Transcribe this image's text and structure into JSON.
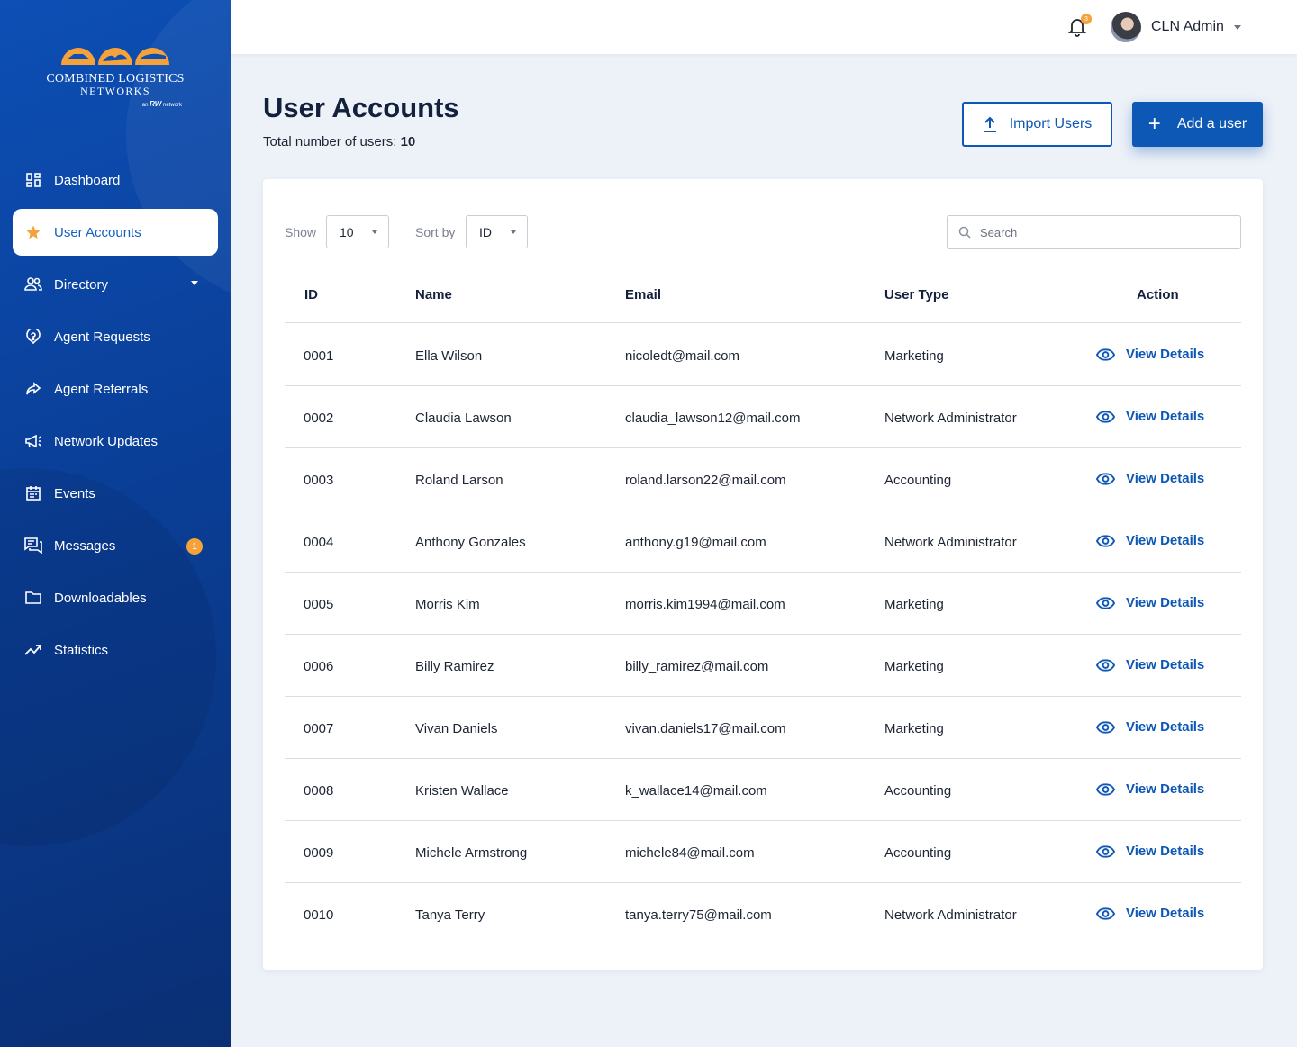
{
  "brand": {
    "name_line1": "COMBINED LOGISTICS",
    "name_line2": "NETWORKS",
    "tagline_prefix": "an",
    "tagline_brand": "RW",
    "tagline_suffix": "network"
  },
  "sidebar": {
    "items": [
      {
        "label": "Dashboard",
        "icon": "dashboard-icon"
      },
      {
        "label": "User Accounts",
        "icon": "star-icon",
        "active": true
      },
      {
        "label": "Directory",
        "icon": "people-icon"
      },
      {
        "label": "Agent Requests",
        "icon": "help-circle-icon"
      },
      {
        "label": "Agent Referrals",
        "icon": "share-icon"
      },
      {
        "label": "Network Updates",
        "icon": "megaphone-icon"
      },
      {
        "label": "Events",
        "icon": "calendar-icon"
      },
      {
        "label": "Messages",
        "icon": "chat-icon",
        "badge": "1"
      },
      {
        "label": "Downloadables",
        "icon": "folder-icon"
      },
      {
        "label": "Statistics",
        "icon": "trending-icon"
      }
    ]
  },
  "topbar": {
    "notification_count": "3",
    "user_name": "CLN Admin"
  },
  "header": {
    "title": "User Accounts",
    "total_label": "Total number of users:",
    "total_value": "10",
    "import_label": "Import Users",
    "add_label": "Add a user"
  },
  "controls": {
    "show_label": "Show",
    "show_value": "10",
    "sort_label": "Sort by",
    "sort_value": "ID",
    "search_placeholder": "Search"
  },
  "table": {
    "columns": [
      "ID",
      "Name",
      "Email",
      "User Type",
      "Action"
    ],
    "action_label": "View Details",
    "rows": [
      {
        "id": "0001",
        "name": "Ella Wilson",
        "email": "nicoledt@mail.com",
        "type": "Marketing"
      },
      {
        "id": "0002",
        "name": "Claudia Lawson",
        "email": "claudia_lawson12@mail.com",
        "type": "Network Administrator"
      },
      {
        "id": "0003",
        "name": "Roland Larson",
        "email": "roland.larson22@mail.com",
        "type": "Accounting"
      },
      {
        "id": "0004",
        "name": "Anthony Gonzales",
        "email": "anthony.g19@mail.com",
        "type": "Network Administrator"
      },
      {
        "id": "0005",
        "name": "Morris Kim",
        "email": "morris.kim1994@mail.com",
        "type": "Marketing"
      },
      {
        "id": "0006",
        "name": "Billy Ramirez",
        "email": "billy_ramirez@mail.com",
        "type": "Marketing"
      },
      {
        "id": "0007",
        "name": "Vivan Daniels",
        "email": "vivan.daniels17@mail.com",
        "type": "Marketing"
      },
      {
        "id": "0008",
        "name": "Kristen Wallace",
        "email": "k_wallace14@mail.com",
        "type": "Accounting"
      },
      {
        "id": "0009",
        "name": "Michele Armstrong",
        "email": "michele84@mail.com",
        "type": "Accounting"
      },
      {
        "id": "0010",
        "name": "Tanya Terry",
        "email": "tanya.terry75@mail.com",
        "type": "Network Administrator"
      }
    ]
  },
  "colors": {
    "primary": "#0d57b5",
    "sidebar": "#0a3f98",
    "accent": "#f5a23a",
    "background": "#edf1f8"
  }
}
